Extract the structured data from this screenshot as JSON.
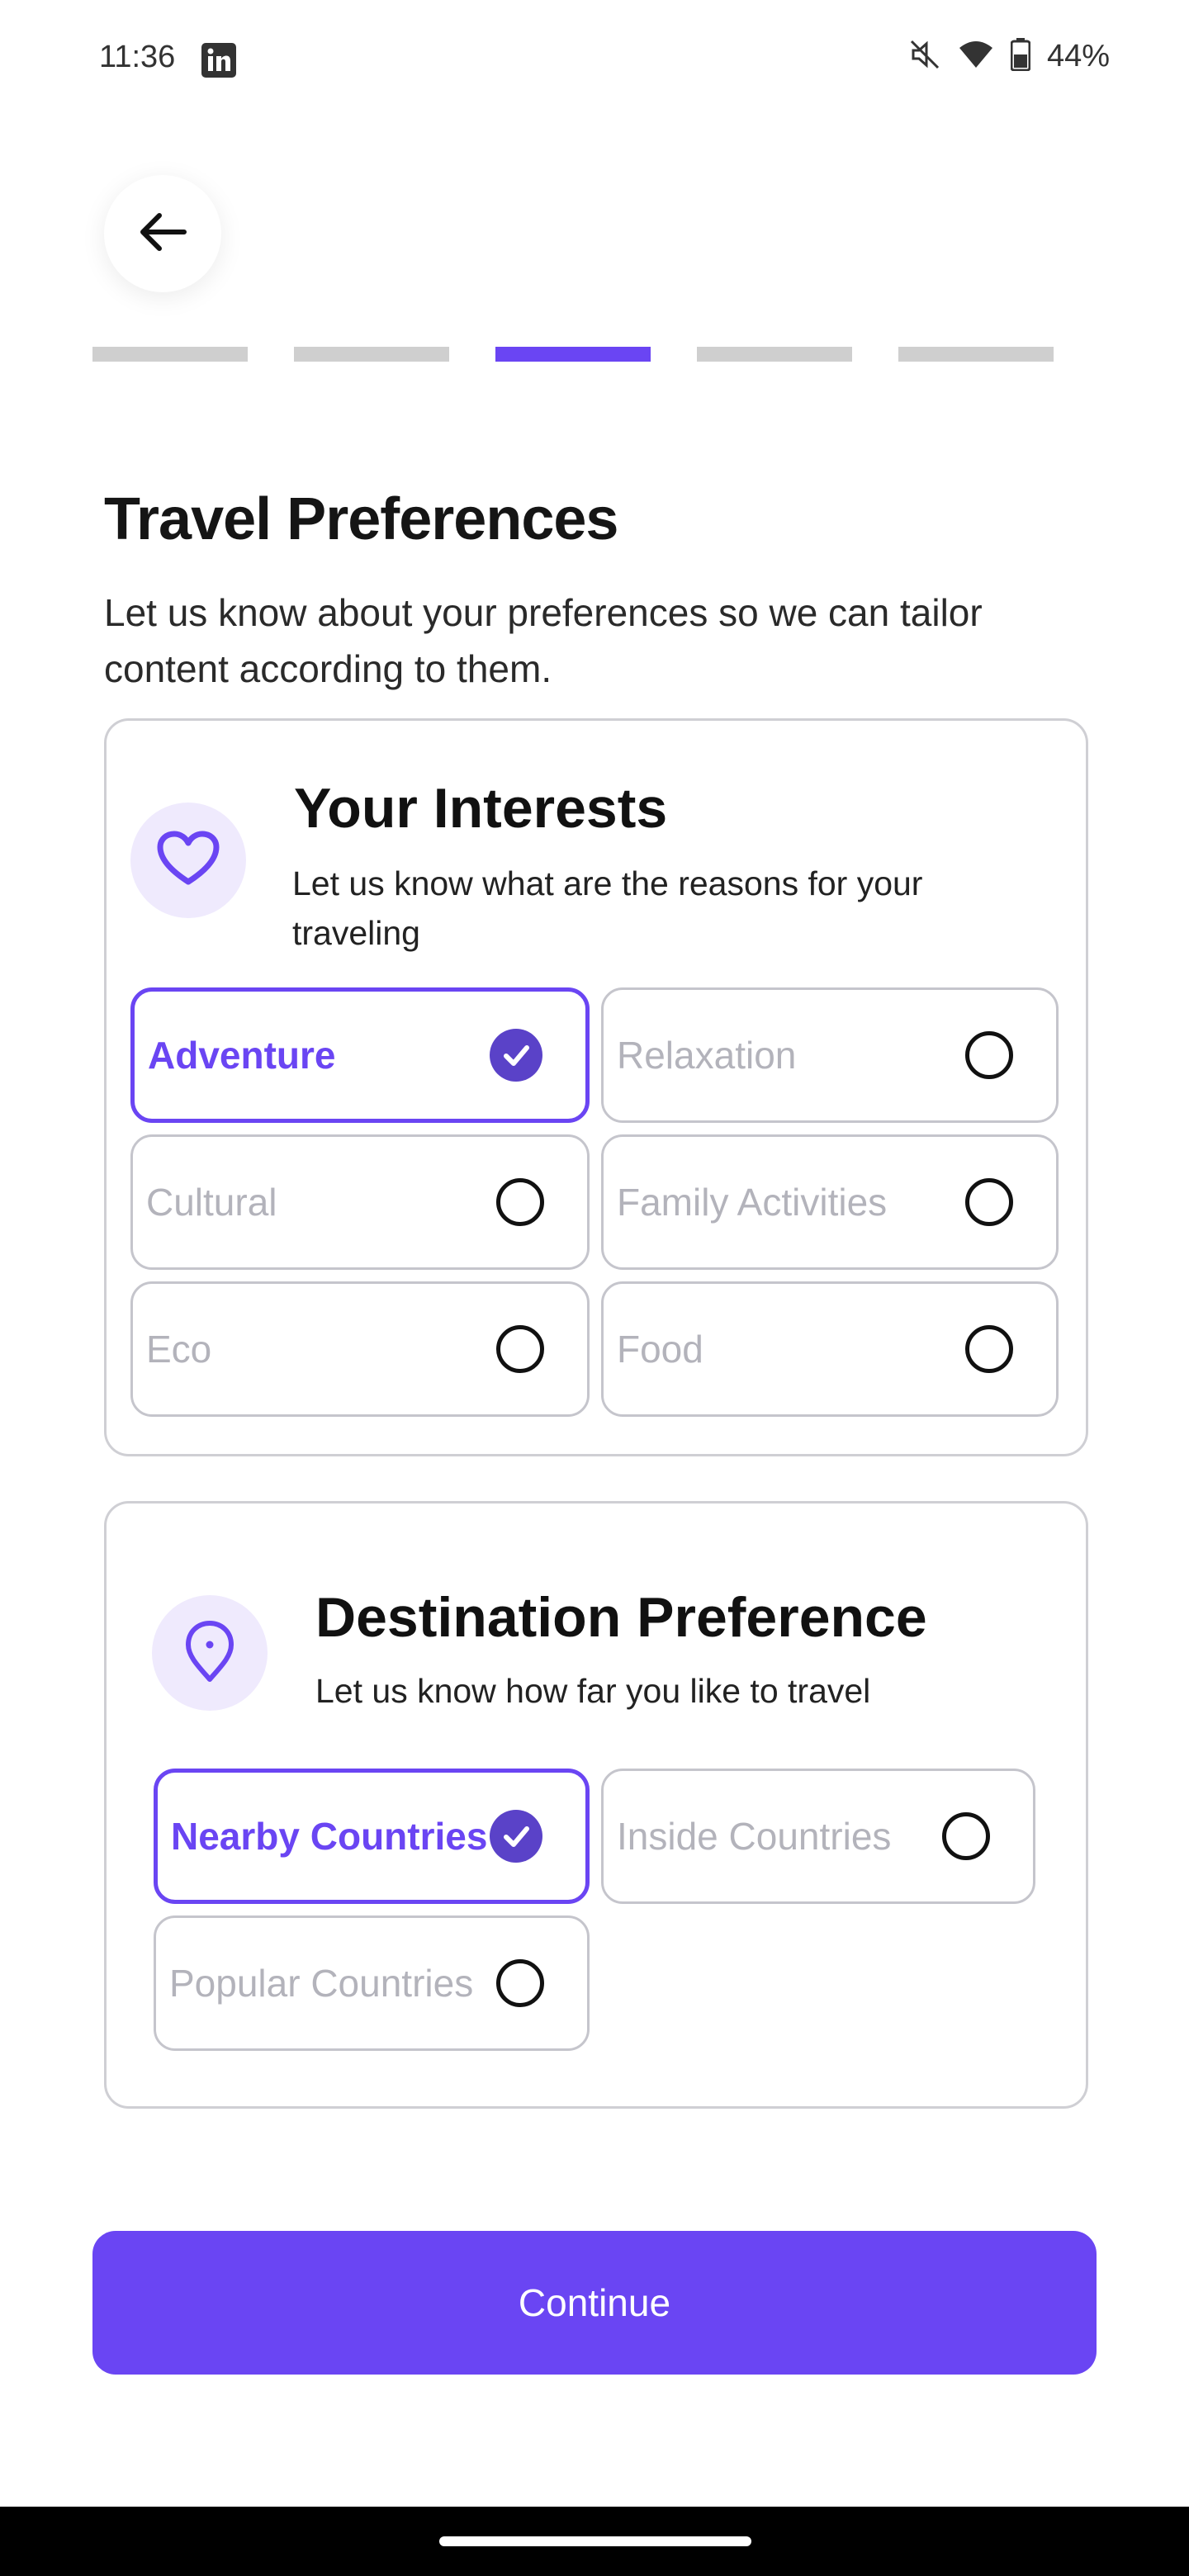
{
  "status_bar": {
    "time": "11:36",
    "app_icon": "linkedin-icon",
    "battery": "44%",
    "icons": [
      "mute-icon",
      "wifi-icon",
      "battery-icon"
    ]
  },
  "header": {
    "back_icon": "arrow-left-icon",
    "steps": [
      {
        "active": false
      },
      {
        "active": false
      },
      {
        "active": true
      },
      {
        "active": false
      },
      {
        "active": false
      }
    ]
  },
  "page": {
    "title": "Travel Preferences",
    "subtitle": "Let us know about your preferences so we can tailor content according to them."
  },
  "interests": {
    "icon": "heart-icon",
    "title": "Your Interests",
    "subtitle": "Let us know what are the reasons for your traveling",
    "options": [
      {
        "label": "Adventure",
        "selected": true
      },
      {
        "label": "Relaxation",
        "selected": false
      },
      {
        "label": "Cultural",
        "selected": false
      },
      {
        "label": "Family Activities",
        "selected": false
      },
      {
        "label": "Eco",
        "selected": false
      },
      {
        "label": "Food",
        "selected": false
      }
    ]
  },
  "destination": {
    "icon": "location-pin-icon",
    "title": "Destination Preference",
    "subtitle": "Let us know how far you like to travel",
    "options": [
      {
        "label": "Nearby Countries",
        "selected": true
      },
      {
        "label": "Inside Countries",
        "selected": false
      },
      {
        "label": "Popular Countries",
        "selected": false
      }
    ]
  },
  "continue_label": "Continue",
  "colors": {
    "accent": "#6a45f3",
    "check_fill": "#5a42c8",
    "icon_bg": "#efeafd",
    "inactive_step": "#cfcfcf"
  }
}
